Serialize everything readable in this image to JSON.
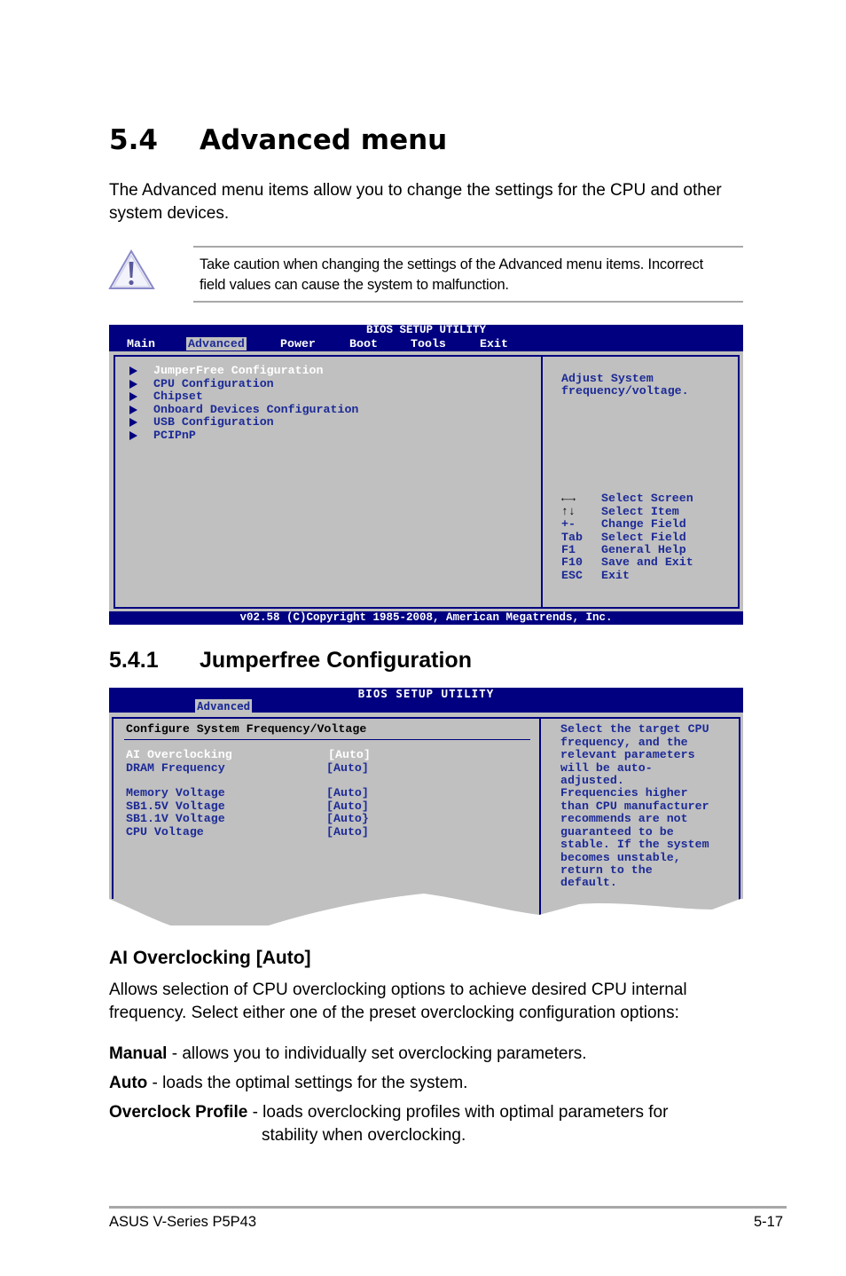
{
  "section": {
    "number": "5.4",
    "title": "Advanced menu",
    "intro": "The Advanced menu items allow you to change the settings for the CPU and other system devices."
  },
  "caution": {
    "icon": "warning-triangle-icon",
    "line1": "Take caution when changing the settings of the Advanced menu items. Incorrect",
    "line2": "field values can cause the system to malfunction."
  },
  "bios_main": {
    "title": "BIOS SETUP UTILITY",
    "tabs": [
      "Main",
      "Advanced",
      "Power",
      "Boot",
      "Tools",
      "Exit"
    ],
    "active_tab": "Advanced",
    "items": [
      "JumperFree Configuration",
      "CPU Configuration",
      "Chipset",
      "Onboard Devices Configuration",
      "USB Configuration",
      "PCIPnP"
    ],
    "selected_item": "JumperFree Configuration",
    "help_text": [
      "Adjust System",
      "frequency/voltage."
    ],
    "keys": [
      {
        "key": "←→",
        "action": "Select Screen"
      },
      {
        "key": "↑↓",
        "action": "Select Item"
      },
      {
        "key": "+-",
        "action": "Change Field"
      },
      {
        "key": "Tab",
        "action": "Select Field"
      },
      {
        "key": "F1",
        "action": "General Help"
      },
      {
        "key": "F10",
        "action": "Save and Exit"
      },
      {
        "key": "ESC",
        "action": "Exit"
      }
    ],
    "footer": "v02.58 (C)Copyright 1985-2008, American Megatrends, Inc."
  },
  "subsection": {
    "number": "5.4.1",
    "title": "Jumperfree Configuration"
  },
  "bios_jumperfree": {
    "title": "BIOS SETUP UTILITY",
    "active_tab": "Advanced",
    "heading": "Configure System Frequency/Voltage",
    "settings": [
      {
        "label": "AI Overclocking",
        "value": "[Auto]",
        "selected": true
      },
      {
        "label": "DRAM Frequency",
        "value": "[Auto]"
      },
      {
        "label": "Memory Voltage",
        "value": "[Auto]"
      },
      {
        "label": "SB1.5V Voltage",
        "value": "[Auto]"
      },
      {
        "label": "SB1.1V Voltage",
        "value": "[Auto}"
      },
      {
        "label": "CPU Voltage",
        "value": "[Auto]"
      }
    ],
    "help_text": [
      "Select the target CPU",
      "frequency, and the",
      "relevant parameters",
      "will be auto-",
      "adjusted.",
      "Frequencies higher",
      "than CPU manufacturer",
      "recommends are not",
      "guaranteed to be",
      "stable. If the system",
      "becomes unstable,",
      "return to the",
      "default."
    ]
  },
  "ai_overclocking": {
    "heading": "AI Overclocking [Auto]",
    "desc_line1": "Allows selection of CPU overclocking options to achieve desired CPU internal",
    "desc_line2": "frequency. Select either one of the preset overclocking configuration options:",
    "options": [
      {
        "term": "Manual",
        "text": " - allows you to individually set overclocking parameters."
      },
      {
        "term": "Auto",
        "text": " - loads the optimal settings for the system."
      },
      {
        "term": "Overclock Profile",
        "text": " - loads overclocking profiles with optimal parameters for",
        "text2": "stability when overclocking."
      }
    ]
  },
  "page_footer": {
    "product": "ASUS V-Series P5P43",
    "page": "5-17"
  },
  "colors": {
    "bios_blue": "#000080",
    "bios_grey": "#c0c0c0",
    "bios_text": "#1c2a96"
  }
}
